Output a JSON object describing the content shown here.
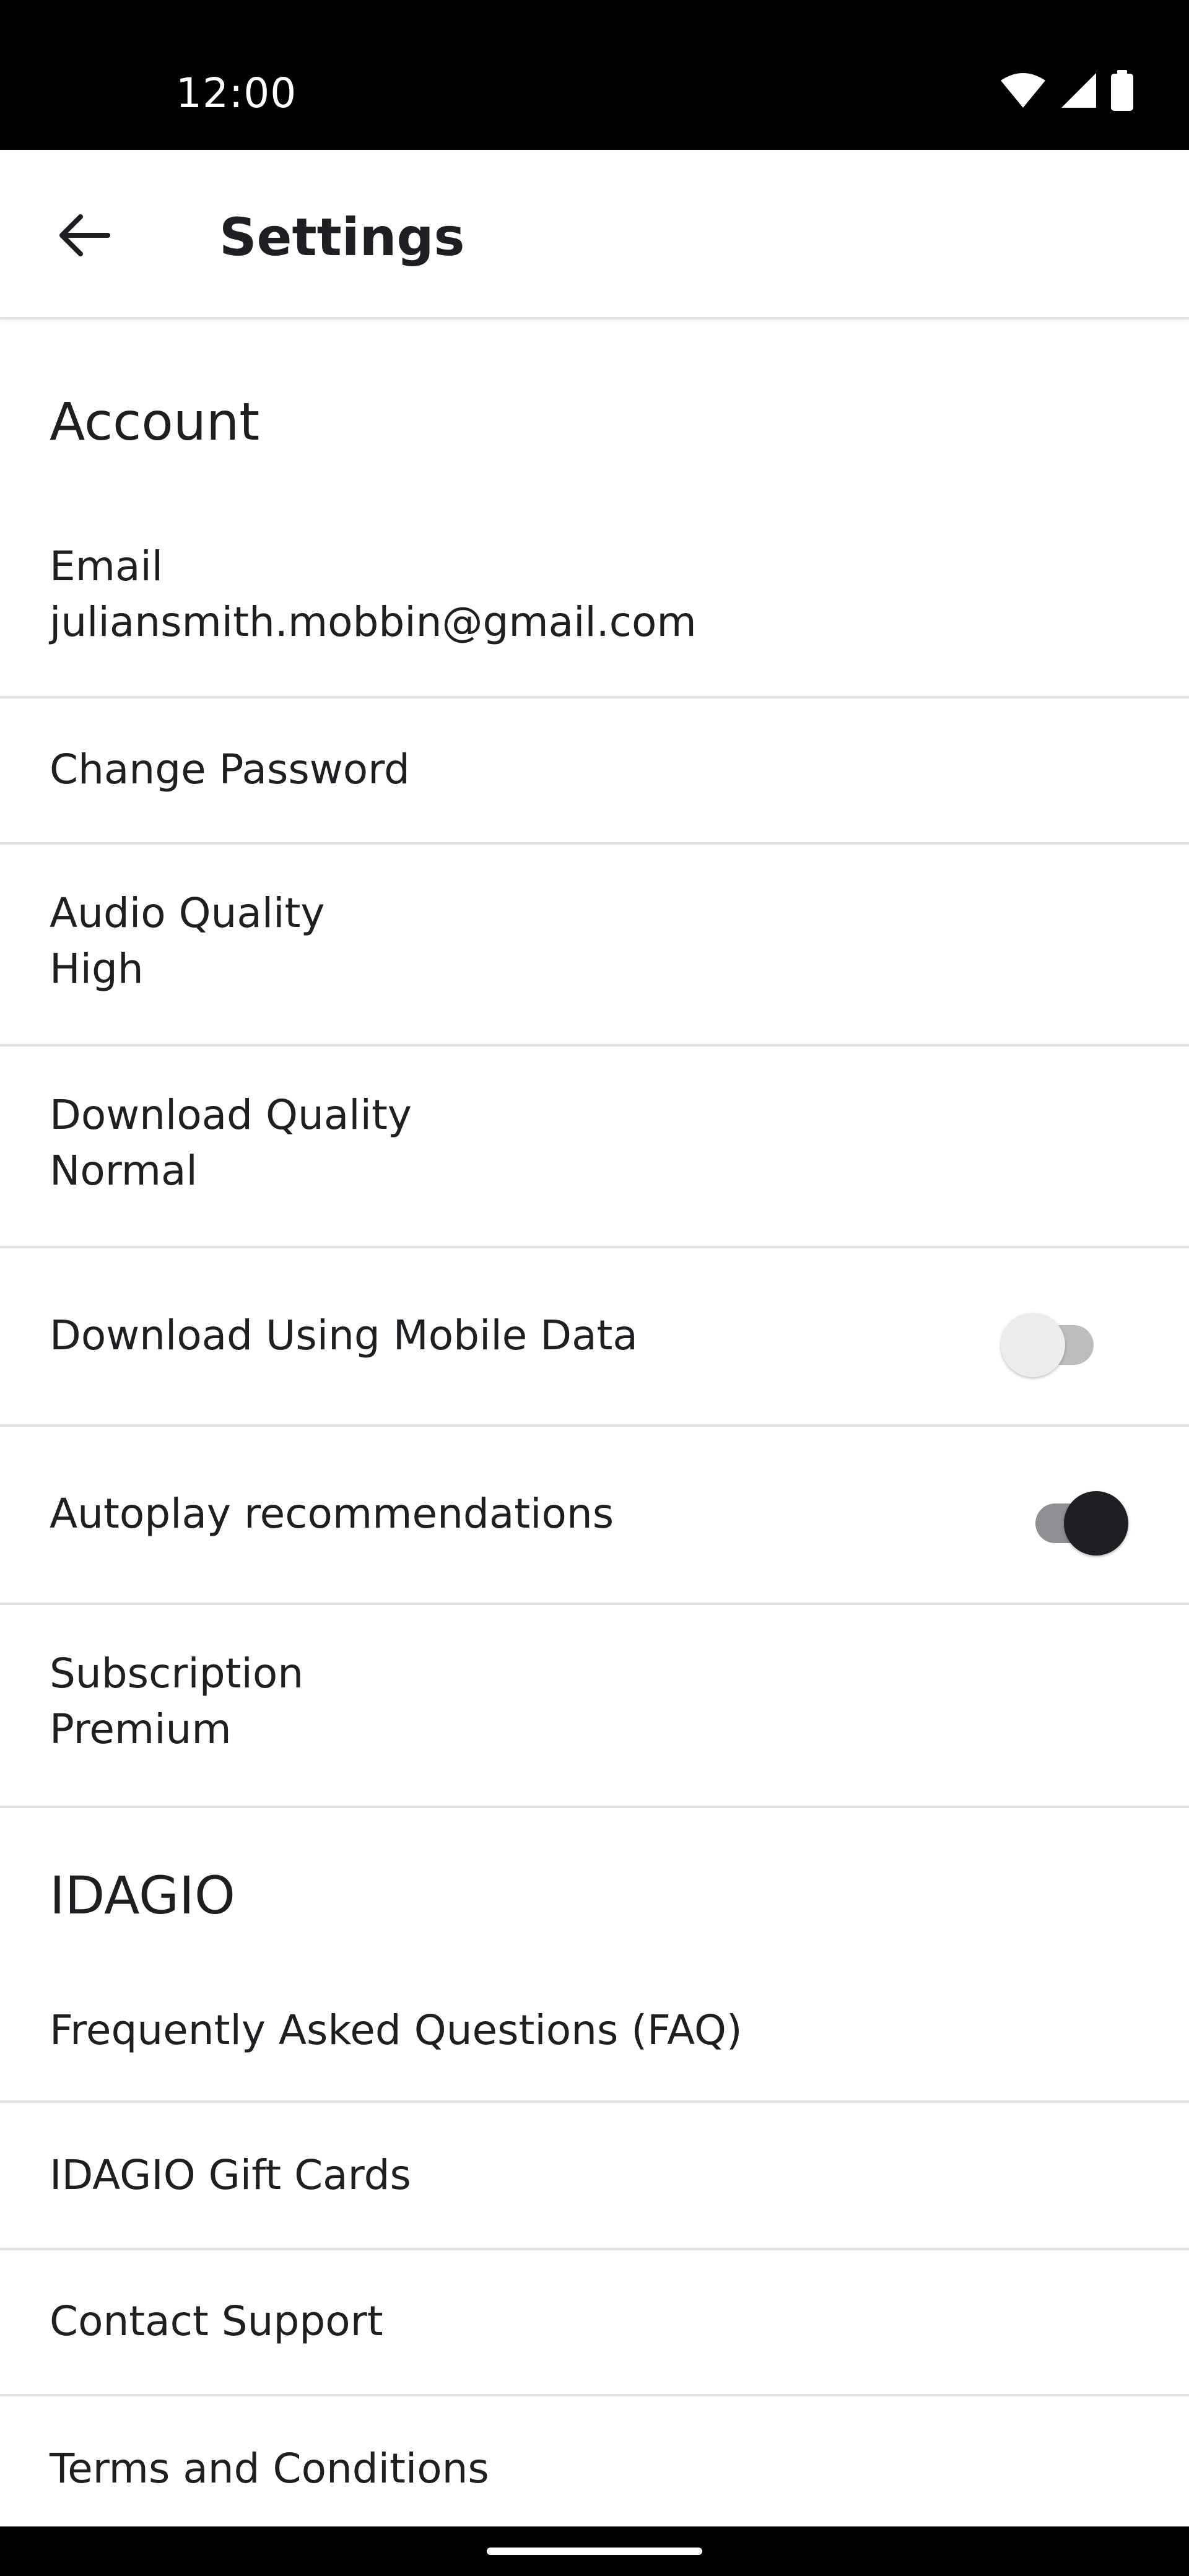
{
  "status_bar": {
    "time": "12:00",
    "icons": [
      "wifi-icon",
      "cellular-signal-icon",
      "battery-icon"
    ]
  },
  "app_bar": {
    "title": "Settings",
    "back_icon": "arrow-left-icon"
  },
  "sections": {
    "account": {
      "header": "Account",
      "email": {
        "label": "Email",
        "value": "juliansmith.mobbin@gmail.com"
      },
      "change_password": {
        "label": "Change Password"
      },
      "audio_quality": {
        "label": "Audio Quality",
        "value": "High"
      },
      "download_quality": {
        "label": "Download Quality",
        "value": "Normal"
      },
      "download_mobile_data": {
        "label": "Download Using Mobile Data",
        "enabled": false
      },
      "autoplay": {
        "label": "Autoplay recommendations",
        "enabled": true
      },
      "subscription": {
        "label": "Subscription",
        "value": "Premium"
      }
    },
    "idagio": {
      "header": "IDAGIO",
      "faq": {
        "label": "Frequently Asked Questions (FAQ)"
      },
      "gift_cards": {
        "label": "IDAGIO Gift Cards"
      },
      "contact_support": {
        "label": "Contact Support"
      },
      "terms": {
        "label": "Terms and Conditions"
      }
    }
  },
  "colors": {
    "text": "#1e1e23",
    "divider": "#e0e0e0",
    "toggle_on_thumb": "#1e1e23",
    "toggle_off_thumb": "#ececec",
    "system_bar": "#000000"
  }
}
